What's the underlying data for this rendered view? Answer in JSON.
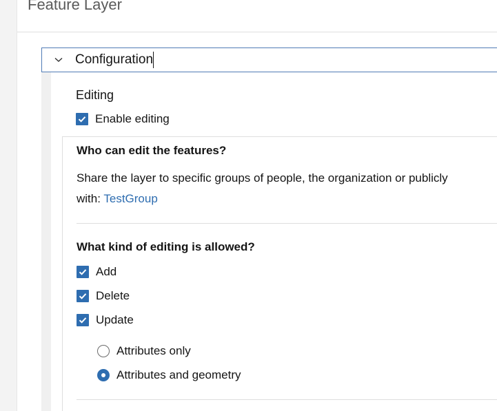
{
  "header": {
    "title": "Feature Layer"
  },
  "section": {
    "title": "Configuration",
    "expanded": true
  },
  "editing": {
    "heading": "Editing",
    "enable_label": "Enable editing",
    "enable_checked": true
  },
  "who_can_edit": {
    "heading": "Who can edit the features?",
    "description": "Share the layer to specific groups of people, the organization or publicly",
    "shared_prefix": "with: ",
    "shared_group": "TestGroup"
  },
  "kind_of_editing": {
    "heading": "What kind of editing is allowed?",
    "options": [
      {
        "label": "Add",
        "checked": true
      },
      {
        "label": "Delete",
        "checked": true
      },
      {
        "label": "Update",
        "checked": true
      }
    ],
    "update_modes": [
      {
        "label": "Attributes only",
        "selected": false
      },
      {
        "label": "Attributes and geometry",
        "selected": true
      }
    ]
  },
  "colors": {
    "accent": "#2e6db0",
    "focus_border": "#4f7bb5",
    "divider": "#dedede"
  }
}
